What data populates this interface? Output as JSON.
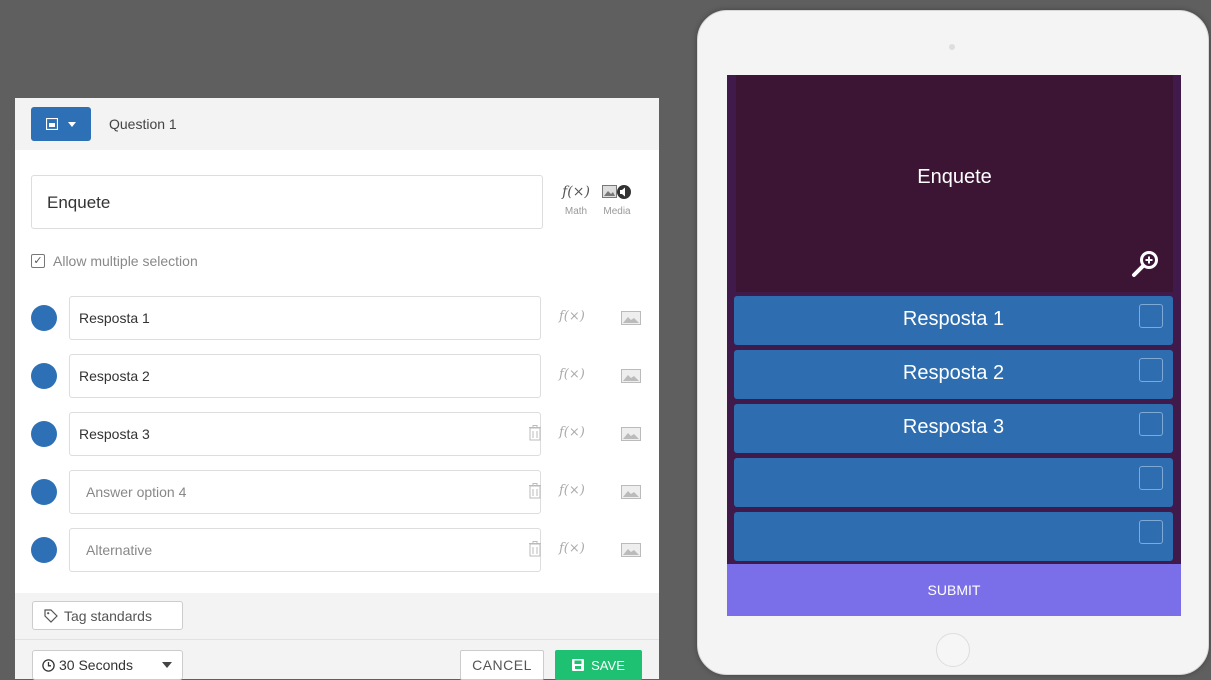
{
  "editor": {
    "header": {
      "question_label": "Question 1"
    },
    "question_text": "Enquete",
    "tools": {
      "math_label": "Math",
      "media_label": "Media",
      "math_symbol": "f(×)"
    },
    "allow_multiple_label": "Allow multiple selection",
    "allow_multiple_checked": true,
    "answers": [
      {
        "value": "Resposta 1",
        "placeholder": "",
        "deletable": false
      },
      {
        "value": "Resposta 2",
        "placeholder": "",
        "deletable": false
      },
      {
        "value": "Resposta 3",
        "placeholder": "",
        "deletable": true
      },
      {
        "value": "",
        "placeholder": "Answer option 4",
        "deletable": true
      },
      {
        "value": "",
        "placeholder": "Alternative",
        "deletable": true
      }
    ],
    "tag_standards_label": "Tag standards",
    "time_limit": "30 Seconds",
    "cancel_label": "CANCEL",
    "save_label": "SAVE"
  },
  "preview": {
    "question_text": "Enquete",
    "options": [
      "Resposta 1",
      "Resposta 2",
      "Resposta 3",
      "",
      ""
    ],
    "submit_label": "SUBMIT"
  },
  "colors": {
    "accent_blue": "#2d70b5",
    "save_green": "#1ec072",
    "preview_bg": "#3f1a4a",
    "submit_purple": "#7b6ee9"
  },
  "icons": [
    "image-type-icon",
    "caret-down-icon",
    "math-icon",
    "media-icon",
    "checkbox-icon",
    "trash-icon",
    "image-icon",
    "tag-icon",
    "clock-icon",
    "save-icon",
    "zoom-in-icon"
  ]
}
